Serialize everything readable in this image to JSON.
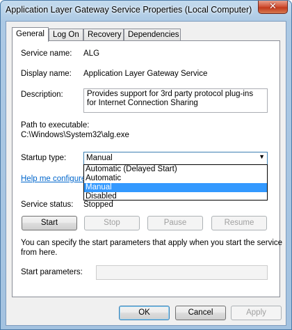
{
  "window": {
    "title": "Application Layer Gateway Service Properties (Local Computer)",
    "close_glyph": "✕"
  },
  "tabs": [
    {
      "label": "General",
      "active": true
    },
    {
      "label": "Log On",
      "active": false
    },
    {
      "label": "Recovery",
      "active": false
    },
    {
      "label": "Dependencies",
      "active": false
    }
  ],
  "general": {
    "service_name_label": "Service name:",
    "service_name_value": "ALG",
    "display_name_label": "Display name:",
    "display_name_value": "Application Layer Gateway Service",
    "description_label": "Description:",
    "description_value": "Provides support for 3rd party protocol plug-ins for Internet Connection Sharing",
    "path_label": "Path to executable:",
    "path_value": "C:\\Windows\\System32\\alg.exe",
    "startup_type_label": "Startup type:",
    "startup_type_value": "Manual",
    "startup_options": [
      {
        "label": "Automatic (Delayed Start)",
        "selected": false
      },
      {
        "label": "Automatic",
        "selected": false
      },
      {
        "label": "Manual",
        "selected": true
      },
      {
        "label": "Disabled",
        "selected": false
      }
    ],
    "help_link": "Help me configure",
    "service_status_label": "Service status:",
    "service_status_value": "Stopped",
    "start_label": "Start",
    "stop_label": "Stop",
    "pause_label": "Pause",
    "resume_label": "Resume",
    "hint_text_1": "You can specify the start parameters that apply when you start the service",
    "hint_text_2": "from here.",
    "start_params_label": "Start parameters:",
    "start_params_value": ""
  },
  "footer": {
    "ok_label": "OK",
    "cancel_label": "Cancel",
    "apply_label": "Apply"
  }
}
